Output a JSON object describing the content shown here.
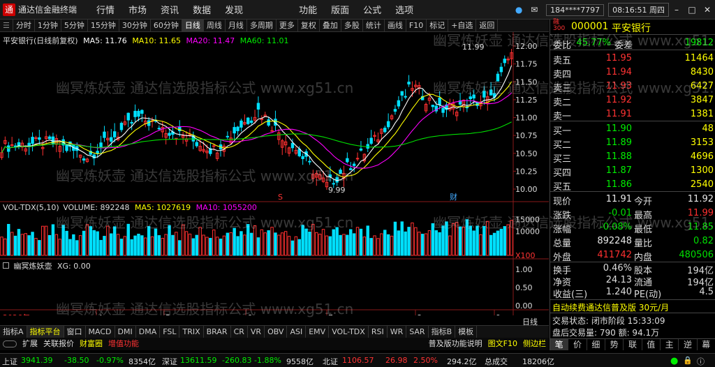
{
  "titlebar": {
    "app_name": "通达信金融终端",
    "menus": [
      "行情",
      "市场",
      "资讯",
      "数据",
      "发现",
      "功能",
      "版面",
      "公式",
      "选项"
    ],
    "account": "184****7797",
    "time": "08:16:51",
    "weekday": "周四"
  },
  "toolbar": {
    "items": [
      "分时",
      "1分钟",
      "5分钟",
      "15分钟",
      "30分钟",
      "60分钟",
      "日线",
      "周线",
      "月线",
      "多周期",
      "更多",
      "复权",
      "叠加",
      "多股",
      "统计",
      "画线",
      "F10",
      "标记",
      "+自选",
      "返回"
    ],
    "active": "日线"
  },
  "chart_header": {
    "stock": "平安银行(日线前复权)",
    "ma5": "MA5: 11.76",
    "ma10": "MA10: 11.65",
    "ma20": "MA20: 11.47",
    "ma60": "MA60: 11.01"
  },
  "price_axis": [
    "12.00",
    "11.75",
    "11.50",
    "11.25",
    "11.00",
    "10.75",
    "10.50",
    "10.25",
    "10.00"
  ],
  "price_annotations": {
    "high": "11.99",
    "low": "9.99",
    "s_marker": "S",
    "cai_marker": "财"
  },
  "volume_header": {
    "label": "VOL-TDX(5,10)",
    "volume": "VOLUME: 892248",
    "ma5": "MA5: 1027619",
    "ma10": "MA10: 1055200"
  },
  "volume_axis": [
    "15000",
    "10000",
    "X100"
  ],
  "indicator_header": {
    "name": "幽冥炼妖壶",
    "xg": "XG: 0.00"
  },
  "indicator_axis": [
    "1.00",
    "0.50",
    "0.00"
  ],
  "date_axis": {
    "year": "2026年",
    "months": [
      "4",
      "5",
      "6",
      "7",
      "8",
      "9"
    ],
    "period": "日线"
  },
  "bottom_tabs": [
    "指标A",
    "指标平台",
    "窗口",
    "MACD",
    "DMI",
    "DMA",
    "FSL",
    "TRIX",
    "BRAR",
    "CR",
    "VR",
    "OBV",
    "ASI",
    "EMV",
    "VOL-TDX",
    "RSI",
    "WR",
    "SAR",
    "指标B",
    "模板"
  ],
  "bottom_tabs_active": "指标平台",
  "bottom_row2": {
    "expand": "扩展",
    "link": "关联报价",
    "wealth": "财富圈",
    "value_add": "增值功能"
  },
  "quote": {
    "code": "000001",
    "name": "平安银行",
    "weibi_label": "委比",
    "weibi": "45.77%",
    "weicha_label": "委差",
    "weicha": "19812",
    "asks": [
      {
        "label": "卖五",
        "price": "11.95",
        "vol": "11464"
      },
      {
        "label": "卖四",
        "price": "11.94",
        "vol": "8430"
      },
      {
        "label": "卖三",
        "price": "11.93",
        "vol": "6427"
      },
      {
        "label": "卖二",
        "price": "11.92",
        "vol": "3847"
      },
      {
        "label": "卖一",
        "price": "11.91",
        "vol": "1381"
      }
    ],
    "bids": [
      {
        "label": "买一",
        "price": "11.90",
        "vol": "48"
      },
      {
        "label": "买二",
        "price": "11.89",
        "vol": "3153"
      },
      {
        "label": "买三",
        "price": "11.88",
        "vol": "4696"
      },
      {
        "label": "买四",
        "price": "11.87",
        "vol": "1300"
      },
      {
        "label": "买五",
        "price": "11.86",
        "vol": "2540"
      }
    ],
    "stats": [
      {
        "l1": "现价",
        "v1": "11.91",
        "c1": "#e8e8e8",
        "l2": "今开",
        "v2": "11.92",
        "c2": "#e8e8e8"
      },
      {
        "l1": "涨跌",
        "v1": "-0.01",
        "c1": "#00e000",
        "l2": "最高",
        "v2": "11.99",
        "c2": "#ff3030"
      },
      {
        "l1": "涨幅",
        "v1": "-0.08%",
        "c1": "#00e000",
        "l2": "最低",
        "v2": "11.85",
        "c2": "#00e000"
      },
      {
        "l1": "总量",
        "v1": "892248",
        "c1": "#e8e8e8",
        "l2": "量比",
        "v2": "0.82",
        "c2": "#00e000"
      },
      {
        "l1": "外盘",
        "v1": "411742",
        "c1": "#ff3030",
        "l2": "内盘",
        "v2": "480506",
        "c2": "#00e000"
      }
    ],
    "stats2": [
      {
        "l1": "换手",
        "v1": "0.46%",
        "l2": "股本",
        "v2": "194亿"
      },
      {
        "l1": "净资",
        "v1": "24.13",
        "l2": "流通",
        "v2": "194亿"
      },
      {
        "l1": "收益(三)",
        "v1": "1.240",
        "l2": "PE(动)",
        "v2": "4.5"
      }
    ],
    "promo": "自动续费通达信普及版 30元/月",
    "trade_status": "交易状态: 闭市阶段 15:33:09",
    "after_hours": "盘后交易量: 790  额: 94.1万",
    "bottom_tabs": [
      "笔",
      "价",
      "细",
      "势",
      "联",
      "值",
      "主",
      "逆",
      "幕"
    ]
  },
  "statusbar": {
    "sh_label": "上证",
    "sh_index": "3941.39",
    "sh_change": "-38.50",
    "sh_pct": "-0.97%",
    "sh_amount": "8354亿",
    "sz_label": "深证",
    "sz_index": "13611.59",
    "sz_change": "-260.83",
    "sz_pct": "-1.88%",
    "sz_amount": "9558亿",
    "bz_label": "北证",
    "bz_index": "1106.57",
    "bz_change": "26.98",
    "bz_pct": "2.50%",
    "bz_amount": "294.2亿",
    "deal_label": "总成交",
    "deal": "18206亿",
    "promo_text": "普及版功能说明",
    "f10": "图文F10",
    "sidebar": "侧边栏"
  },
  "watermark": "幽冥炼妖壶 通达信选股指标公式 www.xg51.cn",
  "colors": {
    "up": "#ff3030",
    "down": "#00e0ff",
    "green": "#00e000",
    "yellow": "#ffff00",
    "ma5": "#ffffff",
    "ma10": "#ffff00",
    "ma20": "#ff00ff",
    "ma60": "#00e000"
  }
}
